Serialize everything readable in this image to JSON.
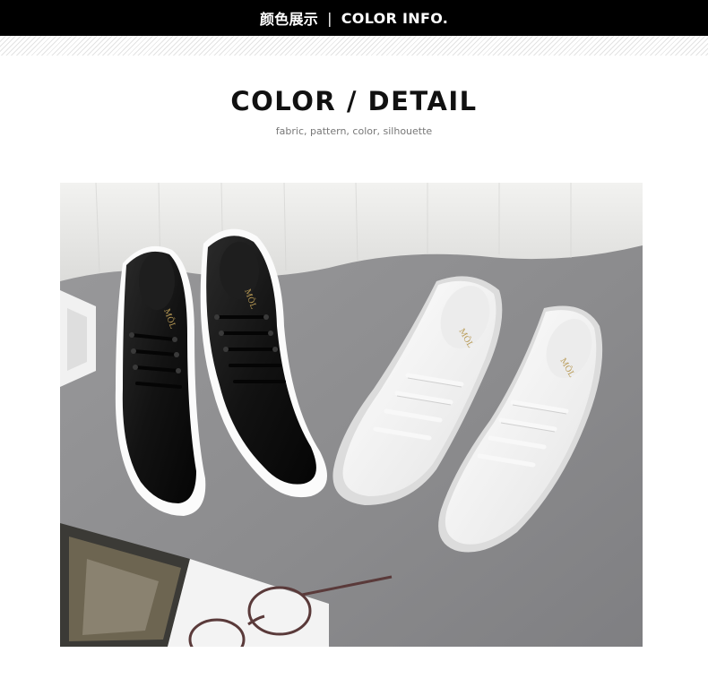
{
  "header": {
    "title_cn": "颜色展示",
    "separator": "|",
    "title_en": "COLOR INFO."
  },
  "section": {
    "title": "COLOR / DETAIL",
    "subtitle": "fabric, pattern, color, silhouette"
  },
  "photo": {
    "brand_mark_black": "MÔL",
    "brand_mark_white_left": "MÔL",
    "brand_mark_white_right": "MÔL",
    "colors": {
      "background_gray": "#8d8d8f",
      "black_shoe": "#151515",
      "white_shoe": "#f4f4f4",
      "curtain": "#ececea"
    }
  }
}
